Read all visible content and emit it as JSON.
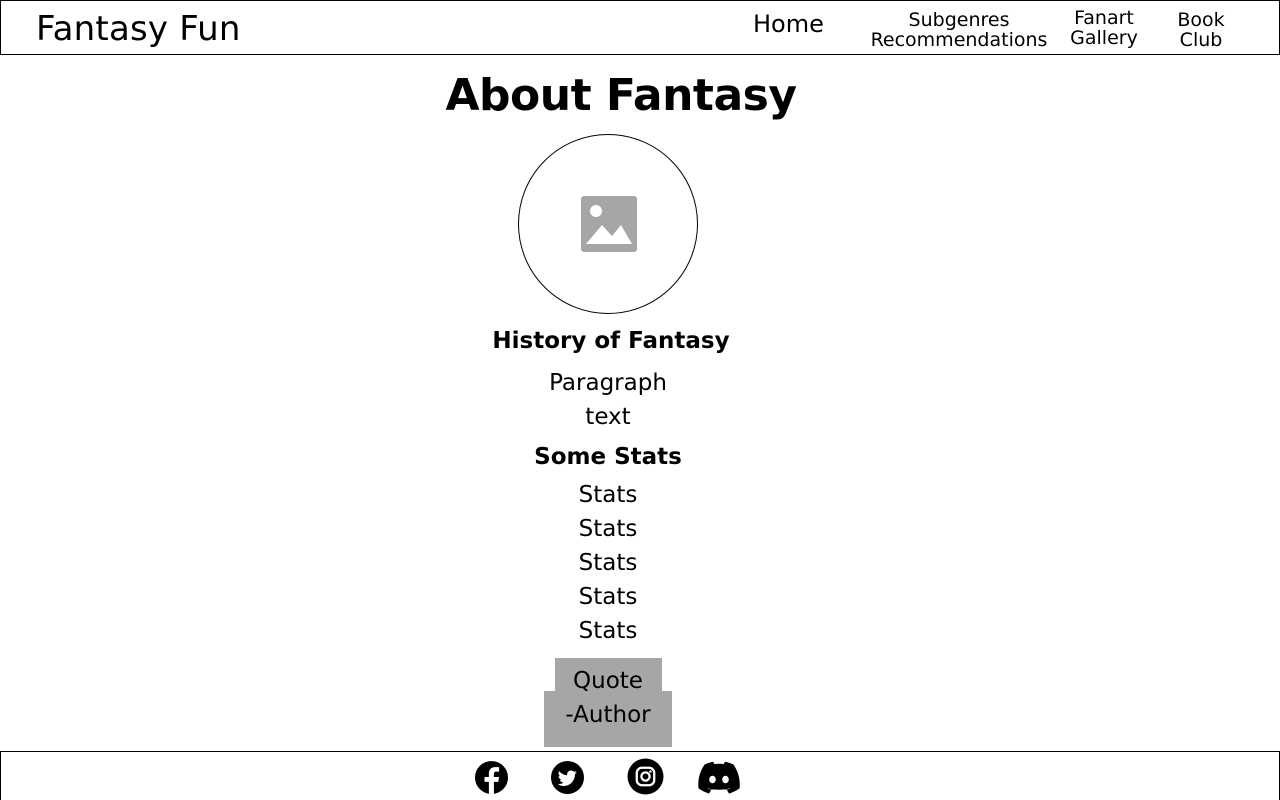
{
  "header": {
    "brand": "Fantasy Fun",
    "nav": {
      "home": "Home",
      "subgenres_line1": "Subgenres",
      "subgenres_line2": "Recommendations",
      "fanart_line1": "Fanart",
      "fanart_line2": "Gallery",
      "book_line1": "Book",
      "book_line2": "Club"
    }
  },
  "main": {
    "title": "About Fantasy",
    "hero_image_icon": "image-placeholder-icon",
    "history": {
      "heading": "History of Fantasy",
      "paragraph_line1": "Paragraph",
      "paragraph_line2": "text"
    },
    "stats": {
      "heading": "Some Stats",
      "items": [
        "Stats",
        "Stats",
        "Stats",
        "Stats",
        "Stats"
      ]
    },
    "quote": {
      "text": "Quote",
      "author": "-Author"
    }
  },
  "footer": {
    "social_icons": [
      "facebook-icon",
      "twitter-icon",
      "instagram-icon",
      "discord-icon"
    ]
  },
  "colors": {
    "placeholder_gray": "#a6a6a6",
    "border": "#000000",
    "background": "#ffffff"
  }
}
